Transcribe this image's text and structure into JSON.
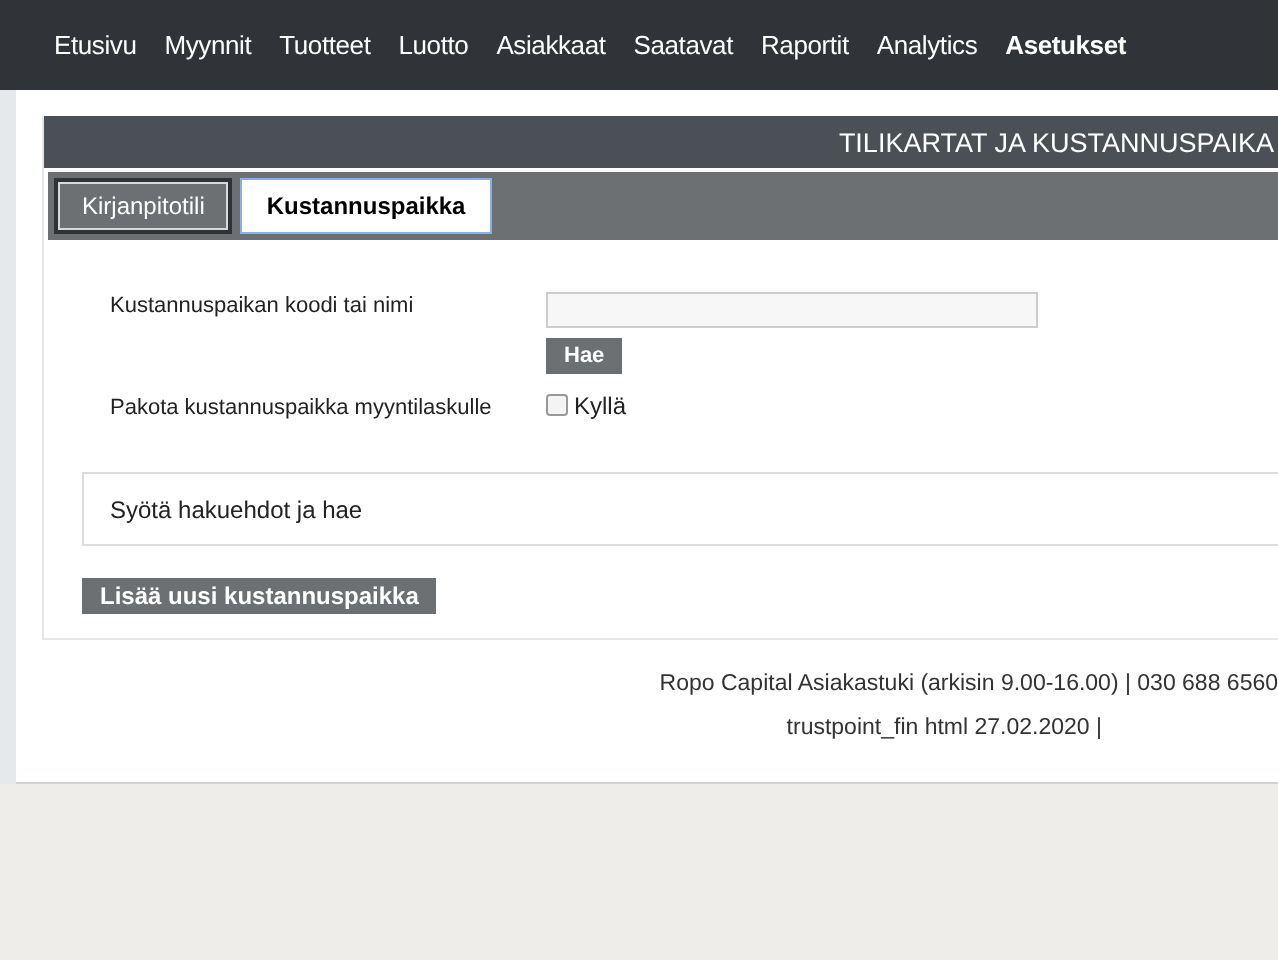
{
  "nav": [
    {
      "label": "Etusivu",
      "selected": false
    },
    {
      "label": "Myynnit",
      "selected": false
    },
    {
      "label": "Tuotteet",
      "selected": false
    },
    {
      "label": "Luotto",
      "selected": false
    },
    {
      "label": "Asiakkaat",
      "selected": false
    },
    {
      "label": "Saatavat",
      "selected": false
    },
    {
      "label": "Raportit",
      "selected": false
    },
    {
      "label": "Analytics",
      "selected": false
    },
    {
      "label": "Asetukset",
      "selected": true
    }
  ],
  "header": {
    "title": "TILIKARTAT JA KUSTANNUSPAIKA"
  },
  "tabs": [
    {
      "label": "Kirjanpitotili",
      "selected": false
    },
    {
      "label": "Kustannuspaikka",
      "selected": true
    }
  ],
  "form": {
    "code_label": "Kustannuspaikan koodi tai nimi",
    "search_button": "Hae",
    "force_label": "Pakota kustannuspaikka myyntilaskulle",
    "force_checkbox": {
      "label": "Kyllä",
      "checked": false
    }
  },
  "results": {
    "message": "Syötä hakuehdot ja hae"
  },
  "add_button": "Lisää uusi kustannuspaikka",
  "footer": [
    "Ropo Capital Asiakastuki (arkisin 9.00-16.00) | 030 688 6560",
    "trustpoint_fin html 27.02.2020 |"
  ]
}
